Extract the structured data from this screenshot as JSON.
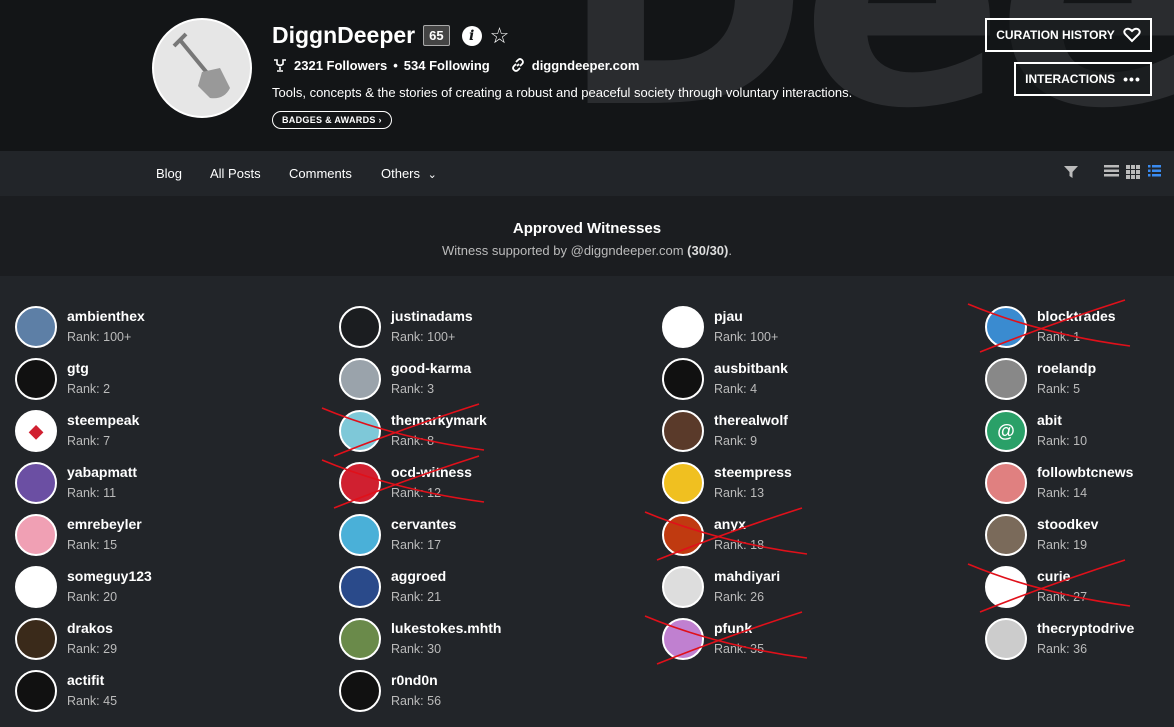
{
  "profile": {
    "cover_text": "Deep",
    "name": "DiggnDeeper",
    "reputation": "65",
    "followers": "2321 Followers",
    "separator": "•",
    "following": "534 Following",
    "website": "diggndeeper.com",
    "about": "Tools, concepts & the stories of creating a robust and peaceful society through voluntary interactions.",
    "badges_label": "BADGES & AWARDS",
    "curation_label": "CURATION HISTORY",
    "interactions_label": "INTERACTIONS"
  },
  "nav": {
    "blog": "Blog",
    "all_posts": "All Posts",
    "comments": "Comments",
    "others": "Others"
  },
  "witness_header": {
    "title": "Approved Witnesses",
    "subtitle_prefix": "Witness supported by @diggndeeper.com ",
    "subtitle_count": "(30/30)",
    "subtitle_suffix": "."
  },
  "colors": {
    "strike": "#e0101a",
    "accent": "#3a8bf0"
  },
  "witnesses": [
    {
      "name": "ambienthex",
      "rank": "Rank: 100+",
      "bg": "#5d7fa6",
      "glyph": "",
      "struck": false
    },
    {
      "name": "gtg",
      "rank": "Rank: 2",
      "bg": "#111",
      "glyph": "",
      "struck": false
    },
    {
      "name": "steempeak",
      "rank": "Rank: 7",
      "bg": "#fff",
      "glyph": "◆",
      "struck": false
    },
    {
      "name": "yabapmatt",
      "rank": "Rank: 11",
      "bg": "#6b4fa3",
      "glyph": "",
      "struck": false
    },
    {
      "name": "emrebeyler",
      "rank": "Rank: 15",
      "bg": "#f0a0b4",
      "glyph": "",
      "struck": false
    },
    {
      "name": "someguy123",
      "rank": "Rank: 20",
      "bg": "#fff",
      "glyph": "",
      "struck": false
    },
    {
      "name": "drakos",
      "rank": "Rank: 29",
      "bg": "#3a2a1a",
      "glyph": "",
      "struck": false
    },
    {
      "name": "actifit",
      "rank": "Rank: 45",
      "bg": "#111",
      "glyph": "",
      "struck": false
    },
    {
      "name": "justinadams",
      "rank": "Rank: 100+",
      "bg": "#1b1d20",
      "glyph": "",
      "struck": false
    },
    {
      "name": "good-karma",
      "rank": "Rank: 3",
      "bg": "#9aa3ab",
      "glyph": "",
      "struck": false
    },
    {
      "name": "themarkymark",
      "rank": "Rank: 8",
      "bg": "#7ec8d8",
      "glyph": "",
      "struck": true
    },
    {
      "name": "ocd-witness",
      "rank": "Rank: 12",
      "bg": "#d02030",
      "glyph": "",
      "struck": true
    },
    {
      "name": "cervantes",
      "rank": "Rank: 17",
      "bg": "#4ab0d8",
      "glyph": "",
      "struck": false
    },
    {
      "name": "aggroed",
      "rank": "Rank: 21",
      "bg": "#2a4a8a",
      "glyph": "",
      "struck": false
    },
    {
      "name": "lukestokes.mhth",
      "rank": "Rank: 30",
      "bg": "#6a8a4a",
      "glyph": "",
      "struck": false
    },
    {
      "name": "r0nd0n",
      "rank": "Rank: 56",
      "bg": "#111",
      "glyph": "",
      "struck": false
    },
    {
      "name": "pjau",
      "rank": "Rank: 100+",
      "bg": "#fff",
      "glyph": "",
      "struck": false
    },
    {
      "name": "ausbitbank",
      "rank": "Rank: 4",
      "bg": "#111",
      "glyph": "",
      "struck": false
    },
    {
      "name": "therealwolf",
      "rank": "Rank: 9",
      "bg": "#5a3a2a",
      "glyph": "",
      "struck": false
    },
    {
      "name": "steempress",
      "rank": "Rank: 13",
      "bg": "#f0c020",
      "glyph": "",
      "struck": false
    },
    {
      "name": "anyx",
      "rank": "Rank: 18",
      "bg": "#c03a10",
      "glyph": "",
      "struck": true
    },
    {
      "name": "mahdiyari",
      "rank": "Rank: 26",
      "bg": "#ddd",
      "glyph": "",
      "struck": false
    },
    {
      "name": "pfunk",
      "rank": "Rank: 35",
      "bg": "#c080d0",
      "glyph": "",
      "struck": true
    },
    {
      "name": "blocktrades",
      "rank": "Rank: 1",
      "bg": "#3a8bd0",
      "glyph": "",
      "struck": true
    },
    {
      "name": "roelandp",
      "rank": "Rank: 5",
      "bg": "#888",
      "glyph": "",
      "struck": false
    },
    {
      "name": "abit",
      "rank": "Rank: 10",
      "bg": "#2aa068",
      "glyph": "@",
      "struck": false
    },
    {
      "name": "followbtcnews",
      "rank": "Rank: 14",
      "bg": "#e08080",
      "glyph": "",
      "struck": false
    },
    {
      "name": "stoodkev",
      "rank": "Rank: 19",
      "bg": "#7a6a5a",
      "glyph": "",
      "struck": false
    },
    {
      "name": "curie",
      "rank": "Rank: 27",
      "bg": "#fff",
      "glyph": "",
      "struck": true
    },
    {
      "name": "thecryptodrive",
      "rank": "Rank: 36",
      "bg": "#ccc",
      "glyph": "",
      "struck": false
    }
  ]
}
